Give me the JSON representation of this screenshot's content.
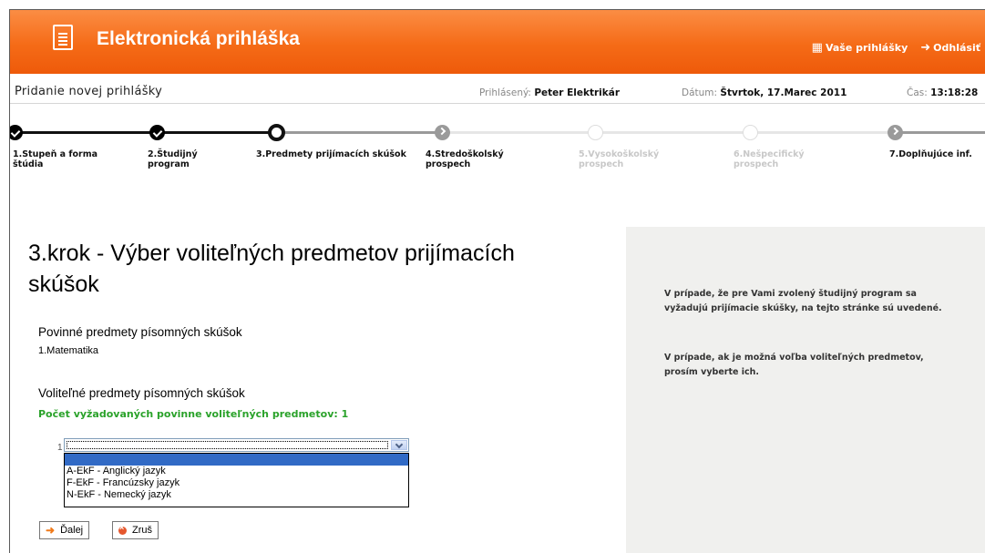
{
  "header": {
    "app_icon": "document-icon",
    "title": "Elektronická prihláška",
    "my_applications_label": "Vaše prihlášky",
    "my_applications_icon": "applications-icon",
    "logout_label": "Odhlásiť",
    "logout_icon": "logout-icon",
    "accent_color": "#f56b17"
  },
  "subheader": {
    "page_title": "Pridanie novej prihlášky",
    "user_label": "Prihlásený:",
    "user_value": "Peter Elektrikár",
    "date_label": "Dátum:",
    "date_value": "Štvrtok, 17.Marec 2011",
    "time_label": "Čas:",
    "time_value": "13:18:28"
  },
  "steps": [
    {
      "label": "1.Stupeň a forma štúdia",
      "state": "done"
    },
    {
      "label": "2.Študijný program",
      "state": "done"
    },
    {
      "label": "3.Predmety prijímacích skúšok",
      "state": "current"
    },
    {
      "label": "4.Stredoškolský prospech",
      "state": "next"
    },
    {
      "label": "5.Vysokoškolský prospech",
      "state": "disabled"
    },
    {
      "label": "6.Nešpecifický prospech",
      "state": "disabled"
    },
    {
      "label": "7.Doplňujúce inf.",
      "state": "next"
    }
  ],
  "main": {
    "title": "3.krok - Výber voliteľných predmetov prijímacích skúšok",
    "mandatory_heading": "Povinné predmety písomných skúšok",
    "mandatory_item": "1.Matematika",
    "optional_heading": "Voliteľné predmety písomných skúšok",
    "required_count_text": "Počet vyžadovaných povinne voliteľných predmetov: 1",
    "select_row_number": "1",
    "select_value": "",
    "dropdown_options": [
      "",
      "A-EkF - Anglický jazyk",
      "F-EkF - Francúzsky jazyk",
      "N-EkF - Nemecký jazyk"
    ],
    "next_label": "Ďalej",
    "cancel_label": "Zruš",
    "success_color": "#2aa22a"
  },
  "info": {
    "p1": "V prípade, že pre Vami zvolený študijný program sa vyžadujú prijímacie skúšky, na tejto stránke sú uvedené.",
    "p2": "V prípade, ak je možná voľba voliteľných predmetov, prosím vyberte ich."
  }
}
